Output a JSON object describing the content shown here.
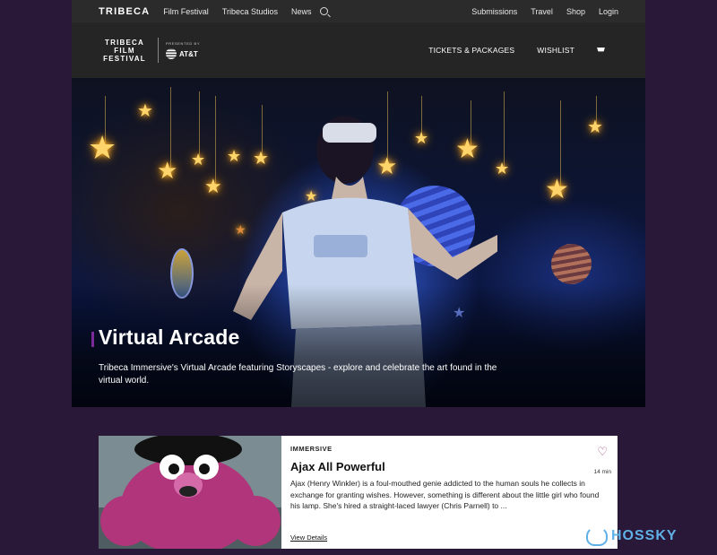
{
  "topnav": {
    "logo": "TRIBECA",
    "left_links": [
      "Film Festival",
      "Tribeca Studios",
      "News"
    ],
    "right_links": [
      "Submissions",
      "Travel",
      "Shop",
      "Login"
    ]
  },
  "subnav": {
    "festival_logo": [
      "TRIBECA",
      "FILM",
      "FESTIVAL"
    ],
    "presented_by": "PRESENTED BY",
    "sponsor": "AT&T",
    "tickets": "TICKETS & PACKAGES",
    "wishlist": "WISHLIST"
  },
  "hero": {
    "title": "Virtual Arcade",
    "description": "Tribeca Immersive's Virtual Arcade featuring Storyscapes - explore and celebrate the art found in the virtual world."
  },
  "card": {
    "tag": "IMMERSIVE",
    "title": "Ajax All Powerful",
    "duration": "14 min",
    "description": "Ajax (Henry Winkler) is a foul-mouthed genie addicted to the human souls he collects in exchange for granting wishes. However, something is different about the little girl who found his lamp. She's hired a straight-laced lawyer (Chris Parnell) to ...",
    "link": "View Details"
  },
  "watermark": "HOSSKY",
  "colors": {
    "background": "#2a1838",
    "accent": "#7a2a9a",
    "heart": "#a03a7a"
  }
}
